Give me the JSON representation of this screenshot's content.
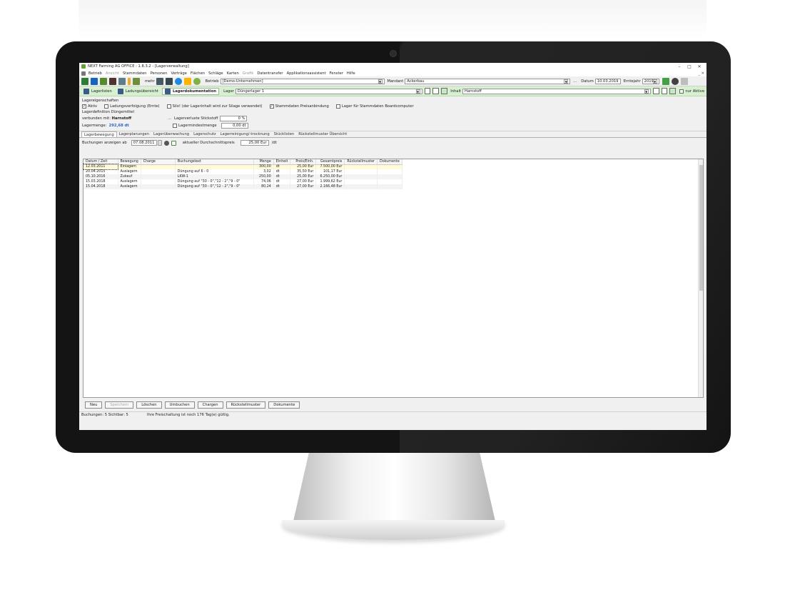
{
  "window": {
    "title": "NEXT Farming AG OFFICE : 1.8.3.2 - [Lagerverwaltung]",
    "minimize": "–",
    "maximize": "□",
    "close": "✕"
  },
  "menu": {
    "items": [
      "Betrieb",
      "Ansicht",
      "Stammdaten",
      "Personen",
      "Verträge",
      "Flächen",
      "Schläge",
      "Karten",
      "Grafik",
      "Datentransfer",
      "Applikationsassistent",
      "Fenster",
      "Hilfe"
    ],
    "disabled": [
      "Ansicht",
      "Grafik"
    ],
    "mdi_controls": "_ ✕"
  },
  "toolbar": {
    "mehr_label": "mehr",
    "betrieb_label": "Betrieb",
    "betrieb_value": "[Demo-Unternehmen]",
    "mandant_label": "Mandant",
    "mandant_value": "Ackerbau",
    "datum_label": "Datum",
    "datum_value": "10.03.2019",
    "erntejahr_label": "Erntejahr",
    "erntejahr_value": "2019",
    "dots": "..."
  },
  "subtoolbar": {
    "tab1": "Lagerlisten",
    "tab2": "Ladungsübersicht",
    "tab3": "Lagerdokumentation",
    "lager_label": "Lager",
    "lager_value": "Düngerlager 1",
    "inhalt_label": "Inhalt",
    "inhalt_value": "Harnstoff",
    "nur_aktive": "nur Aktive"
  },
  "props": {
    "section_title": "Lagereigenschaften",
    "aktiv": "Aktiv",
    "ladungsverfolgung": "Ladungsverfolgung (Ernte)",
    "silo": "Silo! (der Lagerinhalt wird zur Silage verwendet)",
    "stammdaten_preis": "Stammdaten Preisanbindung",
    "lager_boardcomputer": "Lager für Stammdaten Boardcomputer",
    "def_title": "Lagerdefinition Düngemittel",
    "verbunden_label": "verbunden mit:",
    "verbunden_value": "Harnstoff",
    "dots": "...",
    "stickstoff_label": "Lagerverluste Stickstoff",
    "stickstoff_value": "0 %",
    "lagermenge_label": "Lagermenge:",
    "lagermenge_value": "292,68 dt",
    "mindestmenge_label": "Lagermindestmenge",
    "mindestmenge_value": "0,00 dt"
  },
  "subtabs": [
    "Lagerbewegung",
    "Lagerplanungen",
    "Lagerüberwachung",
    "Lagerschutz",
    "Lagerreinigung/-trocknung",
    "Stücklisten",
    "Rückstellmuster Übersicht"
  ],
  "filter": {
    "label": "Buchungen anzeigen ab",
    "date": "07.08.2011",
    "durchschnitt_label": "aktueller Durchschnittspreis",
    "durchschnitt_value": "25,00 Eur",
    "unit": "/dt"
  },
  "grid": {
    "columns": [
      "Datum / Zeit",
      "Bewegung",
      "Charge",
      "Buchungstext",
      "Menge",
      "Einheit",
      "Preis/Einh.",
      "Gesamtpreis",
      "Rückstellmuster",
      "Dokumente"
    ],
    "rows": [
      [
        "12.03.2011",
        "Einlagern",
        "",
        "",
        "300,00",
        "dt",
        "25,00 Eur",
        "7.500,00 Eur",
        "",
        ""
      ],
      [
        "20.04.2015",
        "Auslagern",
        "",
        "Düngung auf 6 - 0",
        "3,02",
        "dt",
        "35,50 Eur",
        "101,17 Eur",
        "",
        ""
      ],
      [
        "05.10.2016",
        "Zukauf",
        "",
        "LKW-1",
        "250,00",
        "dt",
        "25,00 Eur",
        "6.250,00 Eur",
        "",
        ""
      ],
      [
        "15.03.2018",
        "Auslagern",
        "",
        "Düngung auf \"30 - 0\",\"12 - 2\",\"9 - 0\"",
        "74,06",
        "dt",
        "27,00 Eur",
        "1.999,62 Eur",
        "",
        ""
      ],
      [
        "15.04.2018",
        "Auslagern",
        "",
        "Düngung auf \"30 - 0\",\"12 - 2\",\"9 - 0\"",
        "80,24",
        "dt",
        "27,00 Eur",
        "2.166,48 Eur",
        "",
        ""
      ]
    ]
  },
  "buttons": {
    "neu": "Neu",
    "speichern": "Speichern",
    "loeschen": "Löschen",
    "umbuchen": "Umbuchen",
    "chargen": "Chargen",
    "rueckstellmuster": "Rückstellmuster",
    "dokumente": "Dokumente"
  },
  "status": {
    "left": "Buchungen: 5 Sichtbar: 5",
    "right": "Ihre Freischaltung ist noch 176 Tag(e) gültig."
  },
  "colors": {
    "accent_green": "#d7f0d0",
    "selection_yellow": "#fffbd6",
    "bezel": "#141414"
  }
}
